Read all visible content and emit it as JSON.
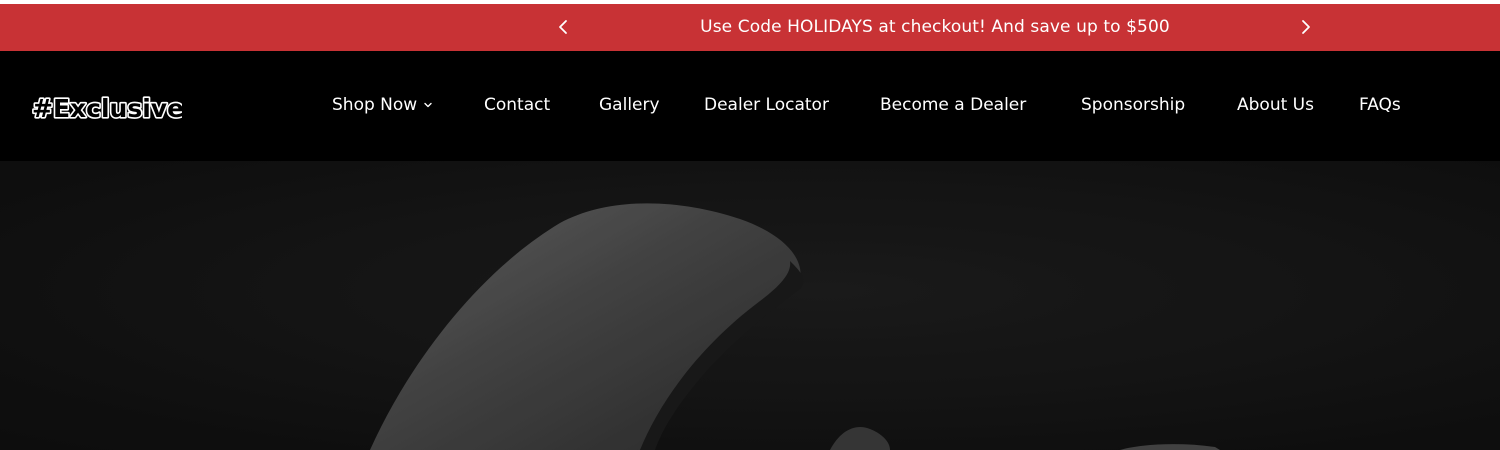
{
  "announcement": {
    "text": "Use Code HOLIDAYS at checkout! And save up to $500",
    "prev_icon": "chevron-left-icon",
    "next_icon": "chevron-right-icon",
    "background_color": "#c83235",
    "text_color": "#ffffff"
  },
  "header": {
    "logo_text": "#Exclusive",
    "background_color": "#000000",
    "nav": [
      {
        "label": "Shop Now",
        "has_dropdown": true,
        "dropdown_icon": "chevron-down-icon"
      },
      {
        "label": "Contact"
      },
      {
        "label": "Gallery"
      },
      {
        "label": "Dealer Locator"
      },
      {
        "label": "Become a Dealer"
      },
      {
        "label": "Sponsorship"
      },
      {
        "label": "About Us"
      },
      {
        "label": "FAQs"
      }
    ]
  },
  "hero": {
    "background_color": "#141414"
  }
}
